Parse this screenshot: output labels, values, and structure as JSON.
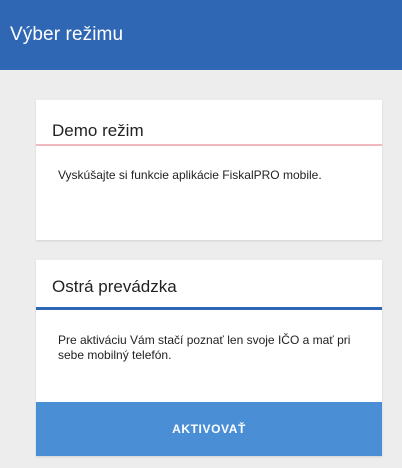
{
  "app_bar": {
    "title": "Výber režimu"
  },
  "cards": {
    "demo": {
      "title": "Demo režim",
      "description": "Vyskúšajte si funkcie aplikácie FiskalPRO mobile."
    },
    "live": {
      "title": "Ostrá prevádzka",
      "description": "Pre aktiváciu Vám stačí poznať len svoje IČO a mať pri sebe mobilný telefón.",
      "button_label": "AKTIVOVAŤ"
    }
  },
  "colors": {
    "app_bar": "#2f67b4",
    "background": "#ededed",
    "demo_divider": "#f1b8bf",
    "live_divider": "#2f67b4",
    "button": "#4a8ed6"
  }
}
